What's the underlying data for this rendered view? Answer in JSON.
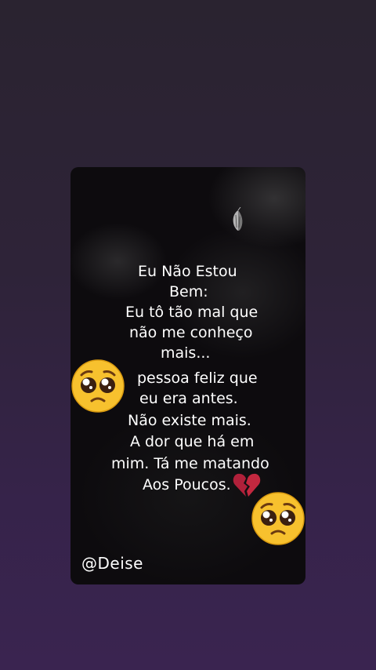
{
  "story": {
    "lines": [
      "Eu Não Estou",
      "Bem:",
      "Eu tô tão mal que",
      "não me conheço",
      "mais...",
      "pessoa feliz que",
      "eu era antes.",
      "Não existe mais.",
      "A dor que há em",
      "mim. Tá me matando",
      "Aos Poucos."
    ],
    "handle": "@Deise",
    "emoji_1": "pleading-face-emoji",
    "emoji_2": "pleading-face-emoji",
    "heart": "broken-heart-emoji",
    "decoration": "butterfly-icon"
  },
  "colors": {
    "background_top": "#2a2330",
    "background_bottom": "#3a2450",
    "card": "#0d0b0e",
    "text": "#ffffff",
    "heart": "#b0203a",
    "emoji": "#f7c12e"
  }
}
